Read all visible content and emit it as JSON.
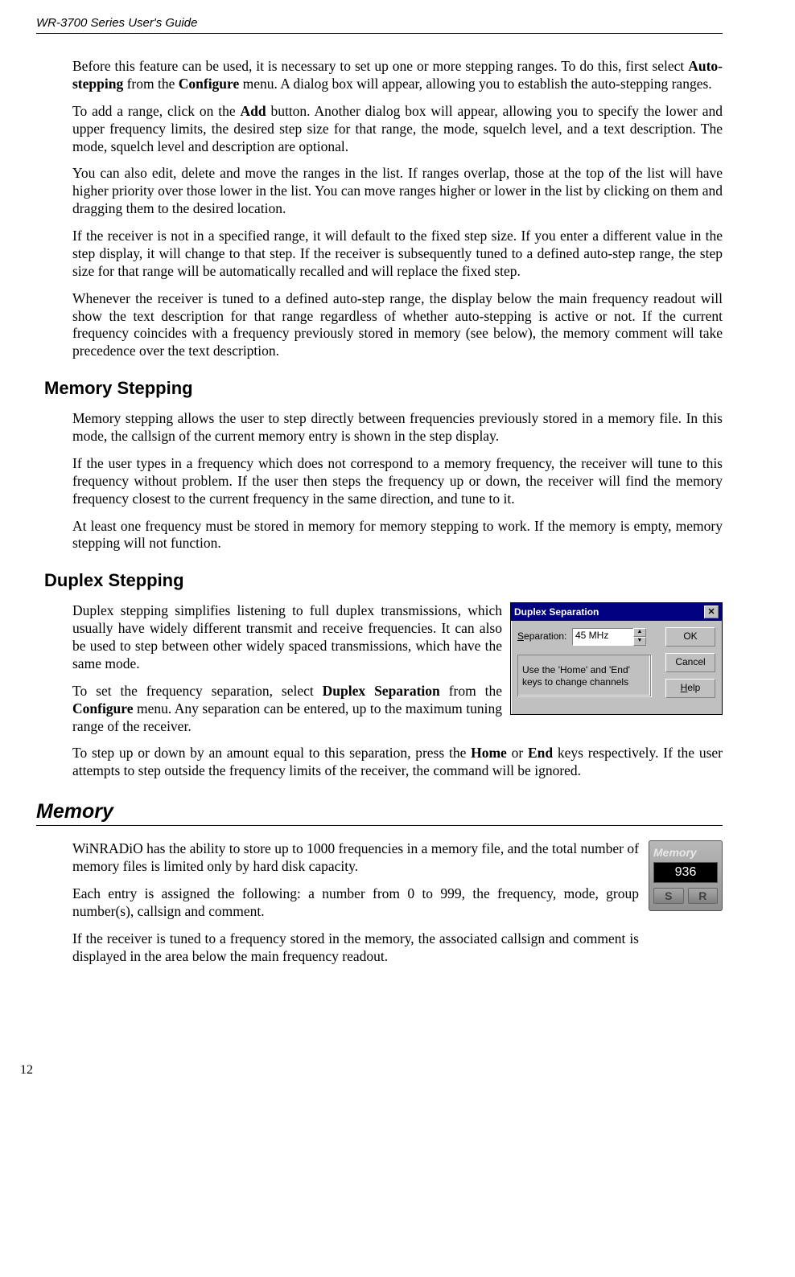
{
  "header": "WR-3700 Series User's Guide",
  "para1_a": "Before this feature can be used, it is necessary to set up one or more stepping ranges. To do this, first select ",
  "para1_b": "Auto-stepping",
  "para1_c": " from the ",
  "para1_d": "Configure",
  "para1_e": " menu. A dialog box will appear, allowing you to establish the auto-stepping ranges.",
  "para2_a": "To add a range, click on the ",
  "para2_b": "Add",
  "para2_c": " button. Another dialog box will appear, allowing you to specify the lower and upper frequency limits, the desired step size for that range, the mode, squelch level, and a text description. The mode, squelch level and description are optional.",
  "para3": "You can also edit, delete and move the ranges in the list. If ranges overlap, those at the top of the list will have higher priority over those lower in the list. You can move ranges higher or lower in the list by clicking on them and dragging them to the desired location.",
  "para4": "If the receiver is not in a specified range, it will default to the fixed step size. If you enter a different value in the step display, it will change to that step. If the receiver is subsequently tuned to a defined auto-step range,  the step size for that range will be automatically recalled and will replace the fixed step.",
  "para5": "Whenever the receiver is tuned to a defined auto-step range, the display below the main frequency readout will show the text description for that range regardless of whether auto-stepping is active or not. If the current frequency coincides with a frequency previously stored in memory (see below), the memory comment will take precedence over the text description.",
  "h_mem_step": "Memory Stepping",
  "ms1": "Memory stepping allows the user to step directly between frequencies previously stored in a memory file. In this mode, the callsign of the current memory entry is shown in the step display.",
  "ms2": "If the user types in a frequency which does not correspond to a memory frequency, the receiver will tune to this frequency without problem. If the user then steps the frequency up or down, the receiver will find the memory frequency closest to the current frequency in the same direction, and tune to it.",
  "ms3": "At least one frequency must be stored in memory for memory stepping to work. If the memory is empty, memory stepping will not function.",
  "h_dup_step": "Duplex Stepping",
  "ds1": "Duplex stepping simplifies listening to full duplex transmissions, which usually have widely different transmit and receive frequencies. It can also be used to step between other widely spaced transmissions, which have the same mode.",
  "ds2_a": "To set the frequency separation, select ",
  "ds2_b": "Duplex Separation",
  "ds2_c": " from the ",
  "ds2_d": "Configure",
  "ds2_e": " menu. Any separation can be entered, up to the maximum tuning range of the receiver.",
  "ds3_a": "To step up or down by an amount equal to this separation, press the ",
  "ds3_b": "Home",
  "ds3_c": " or ",
  "ds3_d": "End",
  "ds3_e": " keys respectively. If  the user attempts to step outside the frequency limits of the receiver, the command will be ignored.",
  "h_memory": "Memory",
  "mem1": "WiNRADiO has the ability to store up to 1000 frequencies in a memory file, and the total number of memory files is limited only by hard disk capacity.",
  "mem2": "Each entry is assigned the following: a number from 0 to 999, the frequency, mode, group number(s), callsign and comment.",
  "mem3": "If the receiver is tuned to a frequency stored in the memory, the associated callsign and comment is displayed in the area below the main frequency readout.",
  "dialog": {
    "title": "Duplex Separation",
    "label_pre": "S",
    "label_rest": "eparation:",
    "value": "45 MHz",
    "hint": "Use the 'Home' and 'End' keys to change channels",
    "ok": "OK",
    "cancel": "Cancel",
    "help_pre": "H",
    "help_rest": "elp"
  },
  "memory_panel": {
    "title": "Memory",
    "value": "936",
    "s": "S",
    "r": "R"
  },
  "page_num": "12"
}
